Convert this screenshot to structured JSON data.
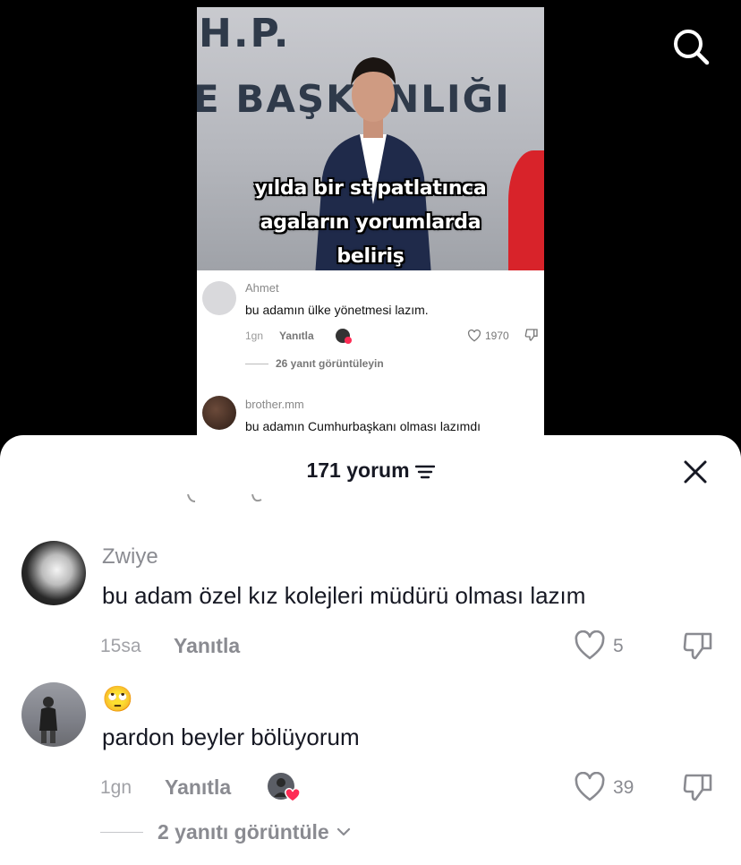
{
  "video": {
    "wall_text_line1": "H.P.",
    "wall_text_line2": "E BAŞKANLIĞI",
    "caption": "yılda bir st patlatınca\nagaların yorumlarda\nbeliriş",
    "embedded_comments": [
      {
        "username": "Ahmet",
        "text": "bu adamın ülke yönetmesi lazım.",
        "time": "1gn",
        "reply_label": "Yanıtla",
        "likes": "1970",
        "view_replies": "26 yanıt görüntüleyin"
      },
      {
        "username": "brother.mm",
        "text": "bu adamın Cumhurbaşkanı olması lazımdı"
      }
    ]
  },
  "icons": {
    "search": "search-icon",
    "close": "close-icon",
    "sort": "sort-icon",
    "heart": "heart-outline-icon",
    "dislike": "thumbs-down-icon",
    "chevron": "chevron-down-icon"
  },
  "colors": {
    "text_primary": "#161823",
    "text_secondary": "#8a8b91",
    "liked_badge": "#fe2c55"
  },
  "sheet": {
    "title": "171 yorum"
  },
  "comments": [
    {
      "username": "Zwiye",
      "text": "bu adam özel kız kolejleri müdürü olması lazım",
      "time": "15sa",
      "reply_label": "Yanıtla",
      "likes": "5"
    },
    {
      "username": "🙄",
      "text": "pardon beyler bölüyorum",
      "time": "1gn",
      "reply_label": "Yanıtla",
      "likes": "39",
      "view_replies": "2 yanıtı görüntüle"
    }
  ]
}
